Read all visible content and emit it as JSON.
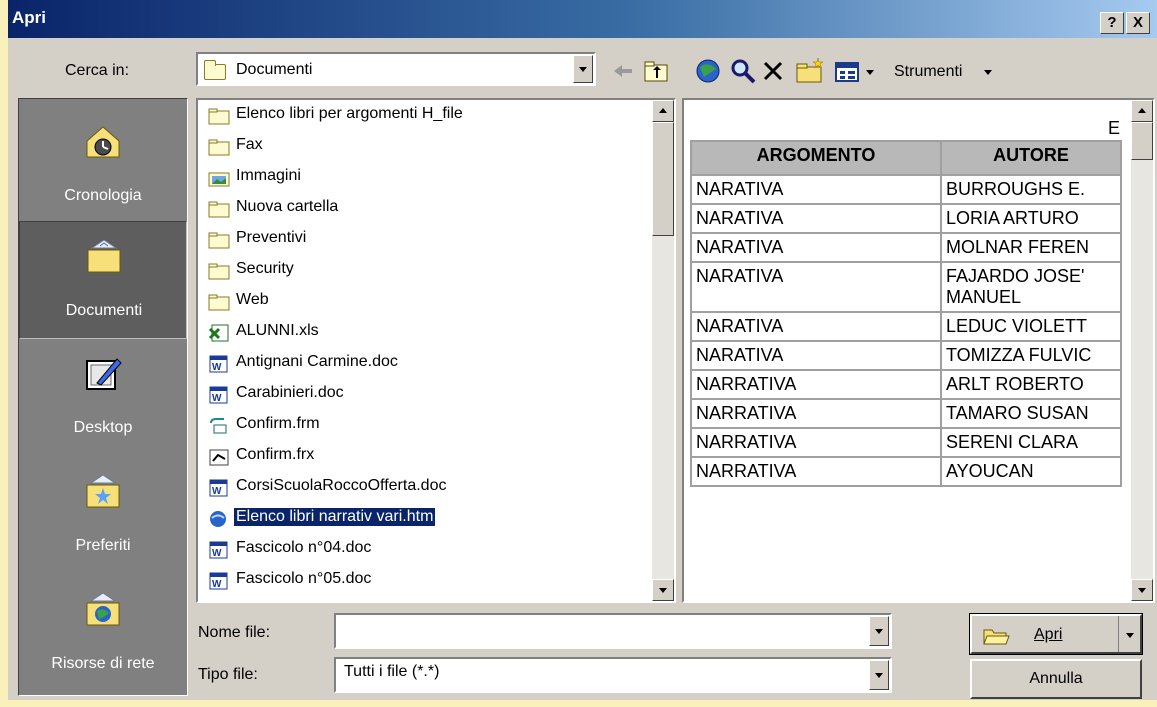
{
  "dialog": {
    "title": "Apri",
    "help_label": "?",
    "close_label": "X"
  },
  "lookin": {
    "label": "Cerca in:",
    "value": "Documenti"
  },
  "toolbar": {
    "back_icon": "back-arrow-icon",
    "up_icon": "up-folder-icon",
    "search_icon": "search-web-icon",
    "delete_icon": "delete-icon",
    "newfolder_icon": "new-folder-icon",
    "views_icon": "views-icon",
    "tools_label": "Strumenti"
  },
  "places": [
    {
      "label": "Cronologia",
      "icon": "history-icon",
      "selected": false
    },
    {
      "label": "Documenti",
      "icon": "my-documents-icon",
      "selected": true
    },
    {
      "label": "Desktop",
      "icon": "desktop-icon",
      "selected": false
    },
    {
      "label": "Preferiti",
      "icon": "favorites-icon",
      "selected": false
    },
    {
      "label": "Risorse di rete",
      "icon": "network-icon",
      "selected": false
    }
  ],
  "files": [
    {
      "name": "Elenco libri per argomenti H_file",
      "type": "folder"
    },
    {
      "name": "Fax",
      "type": "folder"
    },
    {
      "name": "Immagini",
      "type": "image-folder"
    },
    {
      "name": "Nuova cartella",
      "type": "folder"
    },
    {
      "name": "Preventivi",
      "type": "folder"
    },
    {
      "name": "Security",
      "type": "folder"
    },
    {
      "name": "Web",
      "type": "folder"
    },
    {
      "name": "ALUNNI.xls",
      "type": "excel"
    },
    {
      "name": "Antignani Carmine.doc",
      "type": "word"
    },
    {
      "name": "Carabinieri.doc",
      "type": "word"
    },
    {
      "name": "Confirm.frm",
      "type": "form"
    },
    {
      "name": "Confirm.frx",
      "type": "frx"
    },
    {
      "name": "CorsiScuolaRoccoOfferta.doc",
      "type": "word"
    },
    {
      "name": "Elenco libri narrativ vari.htm",
      "type": "html",
      "selected": true
    },
    {
      "name": "Fascicolo n°04.doc",
      "type": "word"
    },
    {
      "name": "Fascicolo n°05.doc",
      "type": "word"
    }
  ],
  "preview": {
    "top_char": "E",
    "headers": [
      "ARGOMENTO",
      "AUTORE"
    ],
    "rows": [
      [
        "NARATIVA",
        "BURROUGHS E."
      ],
      [
        "NARATIVA",
        "LORIA ARTURO"
      ],
      [
        "NARATIVA",
        "MOLNAR FEREN"
      ],
      [
        "NARATIVA",
        "FAJARDO JOSE' MANUEL"
      ],
      [
        "NARATIVA",
        "LEDUC VIOLETT"
      ],
      [
        "NARATIVA",
        "TOMIZZA FULVIC"
      ],
      [
        "NARRATIVA",
        "ARLT ROBERTO"
      ],
      [
        "NARRATIVA",
        "TAMARO SUSAN"
      ],
      [
        "NARRATIVA",
        "SERENI CLARA"
      ],
      [
        "NARRATIVA",
        "AYOUCAN"
      ]
    ]
  },
  "filename": {
    "label": "Nome file:",
    "value": ""
  },
  "filetype": {
    "label": "Tipo file:",
    "value": "Tutti i file (*.*)"
  },
  "buttons": {
    "open_label": "Apri",
    "cancel_label": "Annulla"
  },
  "colors": {
    "title_start": "#0a246a",
    "title_end": "#a6caf0",
    "face": "#d4d0c8",
    "selection": "#0a246a",
    "places_bg": "#808080"
  }
}
